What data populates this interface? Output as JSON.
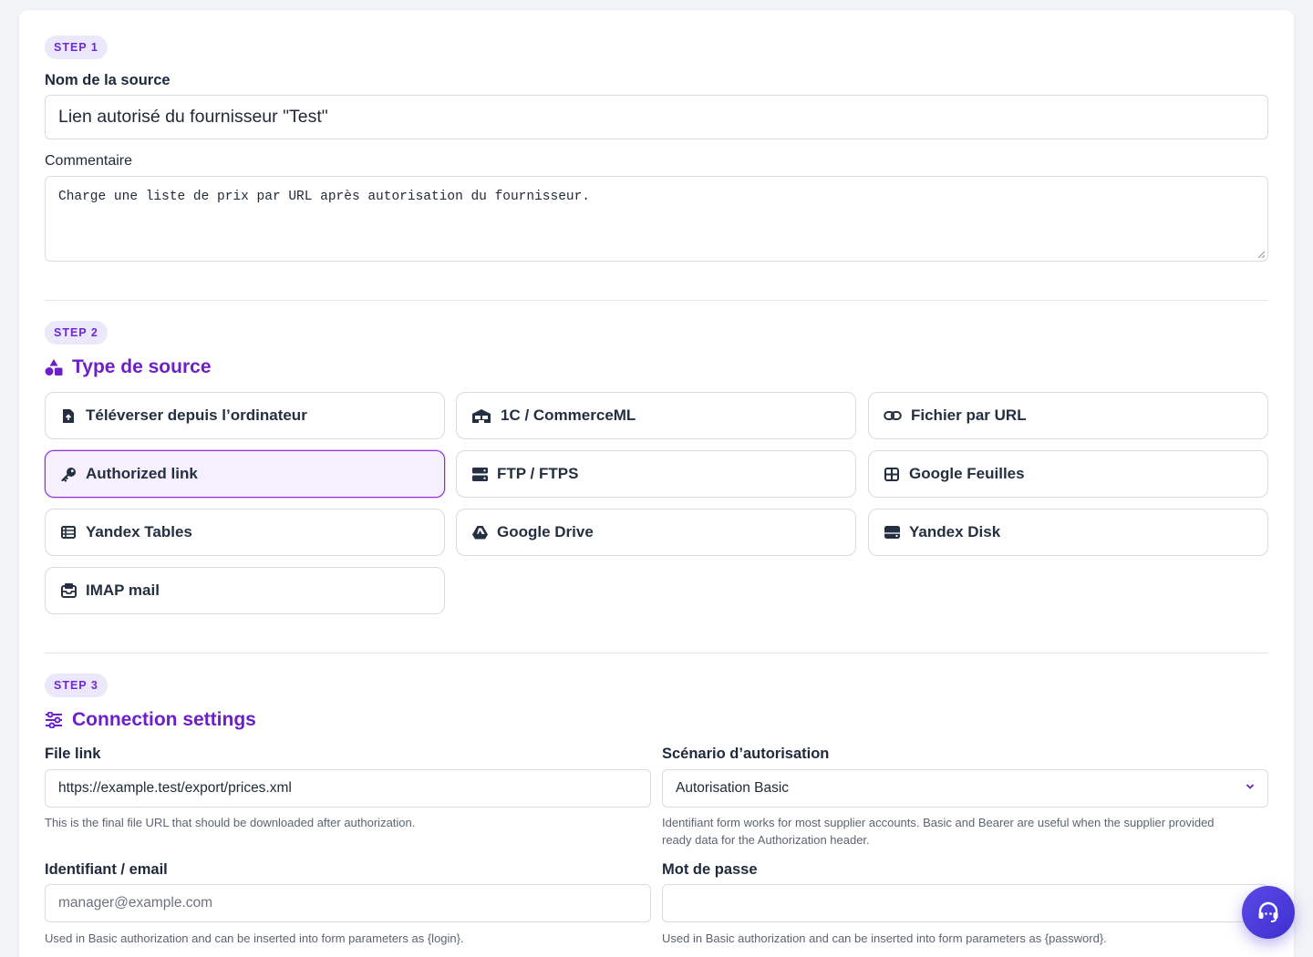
{
  "step1": {
    "badge": "STEP 1",
    "source_name_label": "Nom de la source",
    "source_name_value": "Lien autorisé du fournisseur \"Test\"",
    "comment_label": "Commentaire",
    "comment_value": "Charge une liste de prix par URL après autorisation du fournisseur."
  },
  "step2": {
    "badge": "STEP 2",
    "title": "Type de source",
    "title_icon": "shapes-icon",
    "options": [
      {
        "label": "Téléverser depuis l’ordinateur",
        "icon": "file-upload-icon",
        "selected": false
      },
      {
        "label": "1C / CommerceML",
        "icon": "warehouse-icon",
        "selected": false
      },
      {
        "label": "Fichier par URL",
        "icon": "link-icon",
        "selected": false
      },
      {
        "label": "Authorized link",
        "icon": "key-icon",
        "selected": true
      },
      {
        "label": "FTP / FTPS",
        "icon": "server-icon",
        "selected": false
      },
      {
        "label": "Google Feuilles",
        "icon": "table-grid-icon",
        "selected": false
      },
      {
        "label": "Yandex Tables",
        "icon": "table-list-icon",
        "selected": false
      },
      {
        "label": "Google Drive",
        "icon": "google-drive-icon",
        "selected": false
      },
      {
        "label": "Yandex Disk",
        "icon": "hard-drive-icon",
        "selected": false
      },
      {
        "label": "IMAP mail",
        "icon": "inbox-icon",
        "selected": false
      }
    ]
  },
  "step3": {
    "badge": "STEP 3",
    "title": "Connection settings",
    "title_icon": "sliders-icon",
    "file_link_label": "File link",
    "file_link_value": "https://example.test/export/prices.xml",
    "file_link_help": "This is the final file URL that should be downloaded after authorization.",
    "auth_scenario_label": "Scénario d’autorisation",
    "auth_scenario_value": "Autorisation Basic",
    "auth_scenario_help_line1": "Identifiant form works for most supplier accounts. Basic and Bearer are useful when the supplier provided",
    "auth_scenario_help_line2": "ready data for the Authorization header.",
    "login_label": "Identifiant / email",
    "login_placeholder": "manager@example.com",
    "login_help": "Used in Basic authorization and can be inserted into form parameters as {login}.",
    "password_label": "Mot de passe",
    "password_value": "",
    "password_help": "Used in Basic authorization and can be inserted into form parameters as {password}."
  },
  "support_button": {
    "icon": "headset-icon"
  },
  "colors": {
    "accent": "#6d1fc8",
    "badge_bg": "#ece8fb",
    "selected_bg": "#f6effd",
    "fab": "#4a3bdc"
  }
}
